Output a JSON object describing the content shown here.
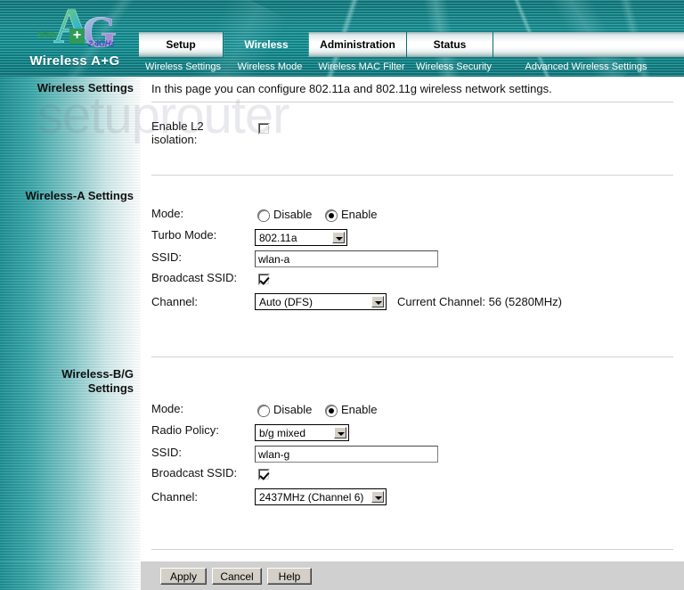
{
  "brand": {
    "name": "Wireless A+G",
    "glyph_a": "A",
    "glyph_g": "G",
    "plus": "+",
    "band_5ghz": "5GHz",
    "band_24ghz": "2.4GHz"
  },
  "watermark": "setuprouter",
  "tabs": [
    {
      "label": "Setup",
      "active": false
    },
    {
      "label": "Wireless",
      "active": true
    },
    {
      "label": "Administration",
      "active": false
    },
    {
      "label": "Status",
      "active": false
    }
  ],
  "subnav": [
    {
      "label": "Wireless Settings",
      "active": true
    },
    {
      "label": "Wireless Mode",
      "active": false
    },
    {
      "label": "Wireless MAC Filter",
      "active": false
    },
    {
      "label": "Wireless Security",
      "active": false
    },
    {
      "label": "Advanced Wireless Settings",
      "active": false
    }
  ],
  "sidebar": {
    "section_wireless_settings": "Wireless Settings",
    "section_wireless_a": "Wireless-A Settings",
    "section_wireless_bg": "Wireless-B/G\nSettings",
    "section_wireless_bg_line1": "Wireless-B/G",
    "section_wireless_bg_line2": "Settings"
  },
  "page": {
    "description": "In this page you can configure 802.11a and 802.11g wireless network settings."
  },
  "general": {
    "l2_isolation_label_line1": "Enable L2",
    "l2_isolation_label_line2": "isolation:",
    "l2_isolation_checked": false
  },
  "wireless_a": {
    "mode_label": "Mode:",
    "mode_disable_label": "Disable",
    "mode_enable_label": "Enable",
    "mode_value": "Enable",
    "turbo_mode_label": "Turbo Mode:",
    "turbo_mode_value": "802.11a",
    "ssid_label": "SSID:",
    "ssid_value": "wlan-a",
    "broadcast_ssid_label": "Broadcast SSID:",
    "broadcast_ssid_checked": true,
    "channel_label": "Channel:",
    "channel_value": "Auto (DFS)",
    "current_channel_note": "Current Channel: 56 (5280MHz)"
  },
  "wireless_bg": {
    "mode_label": "Mode:",
    "mode_disable_label": "Disable",
    "mode_enable_label": "Enable",
    "mode_value": "Enable",
    "radio_policy_label": "Radio Policy:",
    "radio_policy_value": "b/g mixed",
    "ssid_label": "SSID:",
    "ssid_value": "wlan-g",
    "broadcast_ssid_label": "Broadcast SSID:",
    "broadcast_ssid_checked": true,
    "channel_label": "Channel:",
    "channel_value": "2437MHz (Channel 6)"
  },
  "footer": {
    "apply_label": "Apply",
    "cancel_label": "Cancel",
    "help_label": "Help"
  },
  "colors": {
    "banner_teal": "#12898d",
    "sidebar_teal": "#1c8e92",
    "active_tab_text": "#ffffff",
    "footer_gray": "#d0d0d0"
  }
}
